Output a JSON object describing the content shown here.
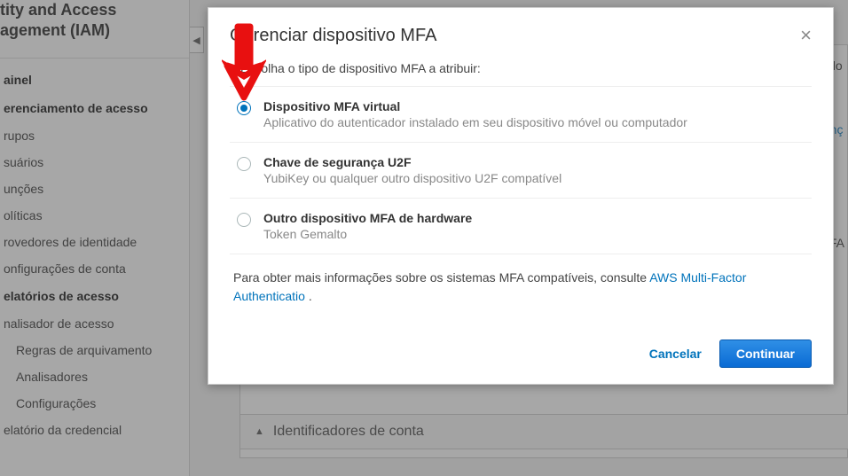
{
  "sidebar": {
    "title_line1": "tity and Access",
    "title_line2": "agement (IAM)",
    "items": [
      {
        "label": "ainel",
        "bold": true
      },
      {
        "label": "erenciamento de acesso",
        "section": true
      },
      {
        "label": "rupos"
      },
      {
        "label": "suários"
      },
      {
        "label": "unções"
      },
      {
        "label": "olíticas"
      },
      {
        "label": "rovedores de identidade"
      },
      {
        "label": "onfigurações de conta"
      },
      {
        "label": "elatórios de acesso",
        "section": true
      },
      {
        "label": "nalisador de acesso"
      },
      {
        "label": "Regras de arquivamento",
        "sub": true
      },
      {
        "label": "Analisadores",
        "sub": true
      },
      {
        "label": "Configurações",
        "sub": true
      },
      {
        "label": "elatório da credencial"
      }
    ]
  },
  "collapse_glyph": "◀",
  "background": {
    "top_right_fragment": "s do",
    "right_link_fragment": "ranç",
    "right_text_fragment": "MFA",
    "account_ident_arrow": "▲",
    "account_ident_label": "Identificadores de conta"
  },
  "modal": {
    "title": "Gerenciar dispositivo MFA",
    "close_glyph": "×",
    "subtitle": "Escolha o tipo de dispositivo MFA a atribuir:",
    "options": [
      {
        "label": "Dispositivo MFA virtual",
        "desc": "Aplicativo do autenticador instalado em seu dispositivo móvel ou computador",
        "selected": true
      },
      {
        "label": "Chave de segurança U2F",
        "desc": "YubiKey ou qualquer outro dispositivo U2F compatível",
        "selected": false
      },
      {
        "label": "Outro dispositivo MFA de hardware",
        "desc": "Token Gemalto",
        "selected": false
      }
    ],
    "more_info_prefix": "Para obter mais informações sobre os sistemas MFA compatíveis, consulte ",
    "more_info_link": "AWS Multi-Factor Authenticatio",
    "more_info_suffix": " .",
    "cancel_label": "Cancelar",
    "continue_label": "Continuar"
  }
}
